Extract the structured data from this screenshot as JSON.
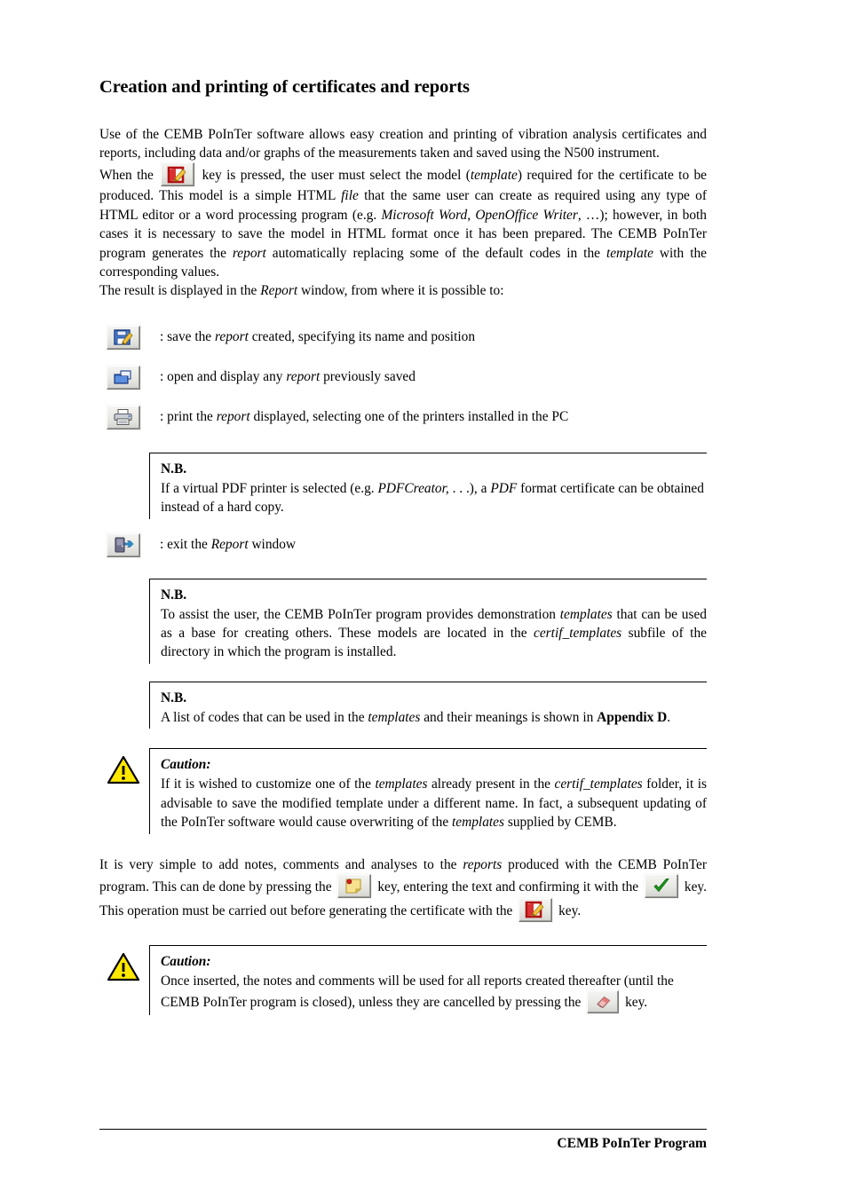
{
  "document": {
    "title": "Creation and printing of certificates and reports",
    "footer": "CEMB PoInTer Program"
  },
  "paragraphs": {
    "intro": {
      "p1_a": "Use of the CEMB PoInTer software allows easy creation and printing of vibration analysis certificates and reports, including data and/or graphs of the measurements taken and saved using the N500 instrument.",
      "p2_a": "When the",
      "p2_b": "key is pressed, the user must select the model (",
      "p2_template": "template",
      "p2_c": ") required for the certificate to be produced. This model is a simple HTML ",
      "p2_file": "file",
      "p2_d": " that the same user can create as required using any type of HTML editor or a word processing program (e.g. ",
      "p2_word": "Microsoft Word",
      "p2_e": ", ",
      "p2_oo": "OpenOffice Writer",
      "p2_f": ", …); however, in both cases it is necessary to save the model in HTML format once it has been prepared. The CEMB PoInTer program generates the ",
      "p2_report": "report",
      "p2_g": " automatically replacing some of the default codes in the ",
      "p2_template2": "template",
      "p2_h": " with the corresponding values.",
      "p3_a": "The result is displayed in the ",
      "p3_report": "Report",
      "p3_b": " window, from where it is possible to:"
    },
    "notes_par": {
      "a": "It is very simple to add notes, comments and analyses to the ",
      "reports": "reports",
      "b": " produced with the CEMB PoInTer program. This can de done by pressing the",
      "c": "key, entering the text and confirming it with the",
      "d": "key. This operation must be carried out before generating the certificate with the",
      "e": "key."
    }
  },
  "icon_list": [
    {
      "icon": "save-report-icon",
      "desc_a": ": save the ",
      "desc_italic": "report",
      "desc_b": " created, specifying its name and position"
    },
    {
      "icon": "open-report-icon",
      "desc_a": ": open and display any ",
      "desc_italic": "report",
      "desc_b": " previously saved"
    },
    {
      "icon": "print-report-icon",
      "desc_a": ": print the ",
      "desc_italic": "report",
      "desc_b": " displayed, selecting one of the printers installed in the PC"
    }
  ],
  "exit_row": {
    "icon": "exit-report-icon",
    "desc_a": ": exit the ",
    "desc_italic": "Report",
    "desc_b": " window"
  },
  "boxes": [
    {
      "type": "nb",
      "head": "N.B.",
      "text_a": "If a virtual PDF printer is selected (e.g. ",
      "text_italic1": "PDFCreator,",
      "text_b": " . . .), a ",
      "text_italic2": "PDF",
      "text_c": " format certificate can be obtained instead of a hard copy."
    },
    {
      "type": "nb",
      "head": "N.B.",
      "text_a": "To assist the user, the CEMB PoInTer program provides demonstration ",
      "text_italic1": "templates",
      "text_b": " that can be used as a base for creating others. These models are located in the ",
      "text_italic2": "certif_templates",
      "text_c": " subfile of the directory in which the program is installed."
    },
    {
      "type": "nb",
      "head": "N.B.",
      "text_a": "A list of codes that can be used in the ",
      "text_italic1": "templates",
      "text_b": " and their meanings is shown in ",
      "text_bold": "Appendix D",
      "text_c": "."
    },
    {
      "type": "caution",
      "head": "Caution:",
      "text_a": "If it is wished to customize one of the ",
      "text_italic1": "templates",
      "text_b": " already present in the ",
      "text_italic2": "certif_templates",
      "text_c": " folder, it is advisable to save the modified template under a different name. In fact, a subsequent updating of the PoInTer software would cause overwriting of the ",
      "text_italic3": "templates",
      "text_d": " supplied by CEMB."
    },
    {
      "type": "caution",
      "head": "Caution:",
      "text_a": "Once inserted, the notes and comments will be used for all reports created thereafter (until the CEMB PoInTer program is closed), unless they are cancelled by pressing the",
      "text_b": "key."
    }
  ],
  "colors": {
    "warning_yellow": "#ffe800",
    "icon_blue": "#3a6fd8",
    "icon_red": "#cc2222",
    "icon_green": "#199919",
    "note_yellow": "#f5e08a"
  }
}
